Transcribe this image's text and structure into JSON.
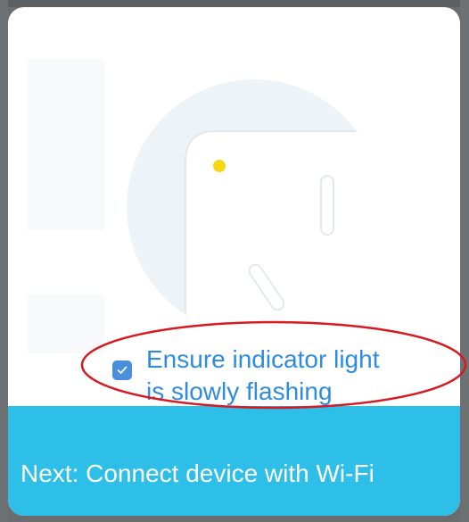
{
  "dialog": {
    "illustration_icon": "device-indicator-illustration",
    "checkbox": {
      "checked": true,
      "icon": "checkmark-icon",
      "label_line1": "Ensure indicator light",
      "label_line2": "is slowly flashing"
    },
    "next_button_label": "Next: Connect device with Wi-Fi"
  },
  "colors": {
    "accent": "#2f8be0",
    "button_background": "#2ebfe9",
    "indicator_light": "#f5d80f",
    "annotation_ellipse": "#d71920"
  }
}
